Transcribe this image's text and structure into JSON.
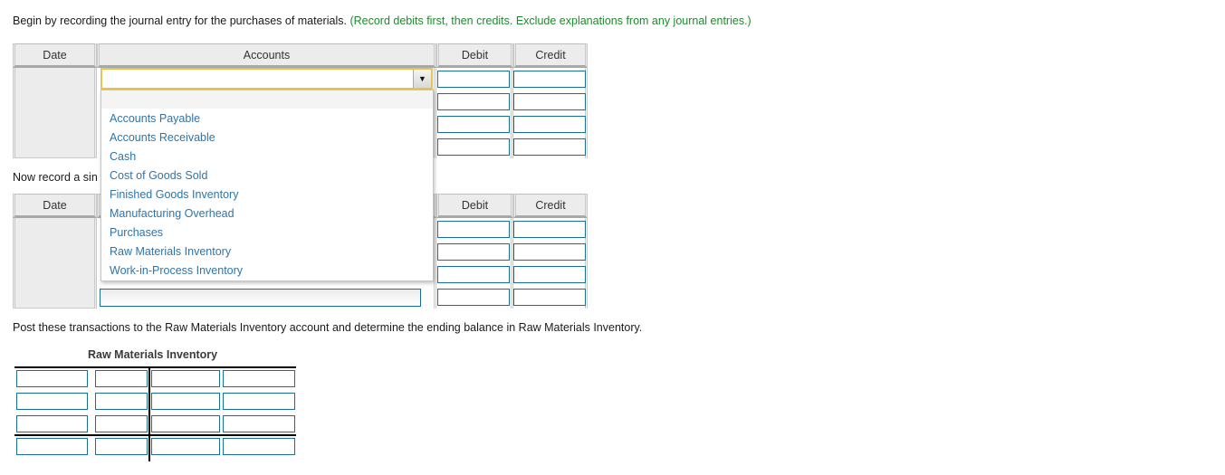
{
  "prompts": {
    "intro_main": "Begin by recording the journal entry for the purchases of materials.",
    "intro_hint": "(Record debits first, then credits. Exclude explanations from any journal entries.)",
    "second_entry": "Now record a sin",
    "post_instruction": "Post these transactions to the Raw Materials Inventory account and determine the ending balance in Raw Materials Inventory."
  },
  "journal_table_1": {
    "headers": {
      "date": "Date",
      "accounts": "Accounts",
      "debit": "Debit",
      "credit": "Credit"
    },
    "rows": [
      {
        "date": "",
        "account": "",
        "debit": "",
        "credit": ""
      },
      {
        "date": "",
        "account": "",
        "debit": "",
        "credit": ""
      },
      {
        "date": "",
        "account": "",
        "debit": "",
        "credit": ""
      },
      {
        "date": "",
        "account": "",
        "debit": "",
        "credit": ""
      }
    ]
  },
  "journal_table_2": {
    "headers": {
      "date": "Date",
      "accounts": "Accounts",
      "debit": "Debit",
      "credit": "Credit"
    },
    "rows": [
      {
        "date": "",
        "account": "",
        "debit": "",
        "credit": ""
      },
      {
        "date": "",
        "account": "",
        "debit": "",
        "credit": ""
      },
      {
        "date": "",
        "account": "",
        "debit": "",
        "credit": ""
      },
      {
        "date": "",
        "account": "",
        "debit": "",
        "credit": ""
      }
    ]
  },
  "account_select": {
    "selected_value": "",
    "arrow_glyph": "▼",
    "expanded": true,
    "blank_option": "",
    "options": [
      "Accounts Payable",
      "Accounts Receivable",
      "Cash",
      "Cost of Goods Sold",
      "Finished Goods Inventory",
      "Manufacturing Overhead",
      "Purchases",
      "Raw Materials Inventory",
      "Work-in-Process Inventory"
    ]
  },
  "t_account": {
    "title": "Raw Materials Inventory",
    "rows": [
      {
        "debit_ref": "",
        "debit_amount": "",
        "credit_ref": "",
        "credit_amount": ""
      },
      {
        "debit_ref": "",
        "debit_amount": "",
        "credit_ref": "",
        "credit_amount": ""
      },
      {
        "debit_ref": "",
        "debit_amount": "",
        "credit_ref": "",
        "credit_amount": ""
      },
      {
        "debit_ref": "",
        "debit_amount": "",
        "credit_ref": "",
        "credit_amount": ""
      }
    ]
  },
  "colors": {
    "hint_green": "#1f8a30",
    "option_blue": "#2f74a8",
    "input_border": "#1a6f97",
    "focus_gold": "#e8c552",
    "header_gray": "#ececec"
  }
}
